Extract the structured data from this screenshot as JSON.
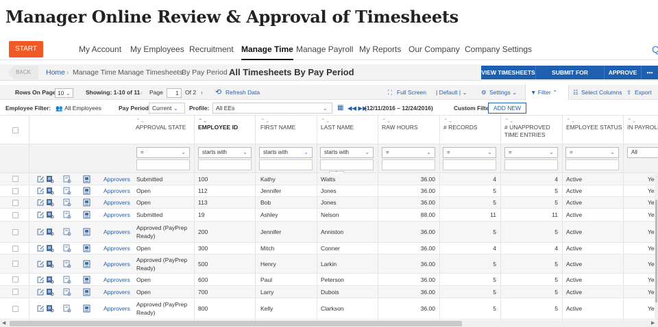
{
  "page_title": "Manager Online Review & Approval of Timesheets",
  "nav": {
    "start": "START",
    "items": [
      "My Account",
      "My Employees",
      "Recruitment",
      "Manage Time",
      "Manage Payroll",
      "My Reports",
      "Our Company",
      "Company Settings"
    ],
    "active": "Manage Time",
    "search_glyph": "Q"
  },
  "breadcrumb": {
    "back": "BACK",
    "home": "Home",
    "items": [
      "Manage Time",
      "Manage Timesheets",
      "By Pay Period"
    ],
    "current": "All Timesheets By Pay Period",
    "actions": [
      "VIEW TIMESHEETS",
      "SUBMIT FOR APPROVAL",
      "APPROVE",
      "•••"
    ]
  },
  "toolbar": {
    "rows_label": "Rows On Page",
    "rows_value": "10",
    "showing": "Showing: 1-10 of 11",
    "page_label": "Page",
    "page_value": "1",
    "page_of": "Of 2",
    "refresh": "Refresh Data",
    "fullscreen": "Full Screen",
    "default": "| Default |",
    "settings": "Settings",
    "filter": "Filter",
    "select_columns": "Select Columns",
    "export": "Export"
  },
  "filterbar": {
    "employee_filter_label": "Employee Filter:",
    "employee_filter_value": "All Employees",
    "pay_period_label": "Pay Period:",
    "pay_period_value": "Current",
    "profile_label": "Profile:",
    "profile_value": "All EEs",
    "date_range": "(12/11/2016 – 12/24/2016)",
    "custom_filter_label": "Custom Filter:",
    "add_new": "ADD NEW"
  },
  "columns": [
    "APPROVAL STATE",
    "EMPLOYEE ID",
    "FIRST NAME",
    "LAST NAME",
    "RAW HOURS",
    "# RECORDS",
    "# UNAPPROVED TIME ENTRIES",
    "EMPLOYEE STATUS",
    "IN PAYROLL"
  ],
  "column_filters": [
    "=",
    "starts with",
    "starts with",
    "starts with",
    "=",
    "=",
    "=",
    "=",
    "All"
  ],
  "approvers_link": "Approvers",
  "rows": [
    {
      "state": "Submitted",
      "id": "100",
      "first": "Kathy",
      "last": "Watts",
      "hours": "36.00",
      "records": "4",
      "unapproved": "4",
      "status": "Active",
      "payroll": "Yes"
    },
    {
      "state": "Open",
      "id": "112",
      "first": "Jennifer",
      "last": "Jones",
      "hours": "36.00",
      "records": "5",
      "unapproved": "5",
      "status": "Active",
      "payroll": "Yes"
    },
    {
      "state": "Open",
      "id": "113",
      "first": "Bob",
      "last": "Jones",
      "hours": "36.00",
      "records": "5",
      "unapproved": "5",
      "status": "Active",
      "payroll": "Yes"
    },
    {
      "state": "Submitted",
      "id": "19",
      "first": "Ashley",
      "last": "Nelson",
      "hours": "88.00",
      "records": "11",
      "unapproved": "11",
      "status": "Active",
      "payroll": "Yes"
    },
    {
      "state": "Approved (PayPrep Ready)",
      "id": "200",
      "first": "Jennifer",
      "last": "Anniston",
      "hours": "36.00",
      "records": "5",
      "unapproved": "5",
      "status": "Active",
      "payroll": "Yes"
    },
    {
      "state": "Open",
      "id": "300",
      "first": "Mitch",
      "last": "Conner",
      "hours": "36.00",
      "records": "4",
      "unapproved": "4",
      "status": "Active",
      "payroll": "Yes"
    },
    {
      "state": "Approved (PayPrep Ready)",
      "id": "500",
      "first": "Henry",
      "last": "Larkin",
      "hours": "36.00",
      "records": "5",
      "unapproved": "5",
      "status": "Active",
      "payroll": "Yes"
    },
    {
      "state": "Open",
      "id": "600",
      "first": "Paul",
      "last": "Peterson",
      "hours": "36.00",
      "records": "5",
      "unapproved": "5",
      "status": "Active",
      "payroll": "Yes"
    },
    {
      "state": "Open",
      "id": "700",
      "first": "Larry",
      "last": "Dubois",
      "hours": "36.00",
      "records": "5",
      "unapproved": "5",
      "status": "Active",
      "payroll": "Yes"
    },
    {
      "state": "Approved (PayPrep Ready)",
      "id": "800",
      "first": "Kelly",
      "last": "Clarkson",
      "hours": "36.00",
      "records": "5",
      "unapproved": "5",
      "status": "Active",
      "payroll": "Yes"
    }
  ],
  "colors": {
    "accent": "#1f5fb0",
    "start": "#f05a28"
  }
}
